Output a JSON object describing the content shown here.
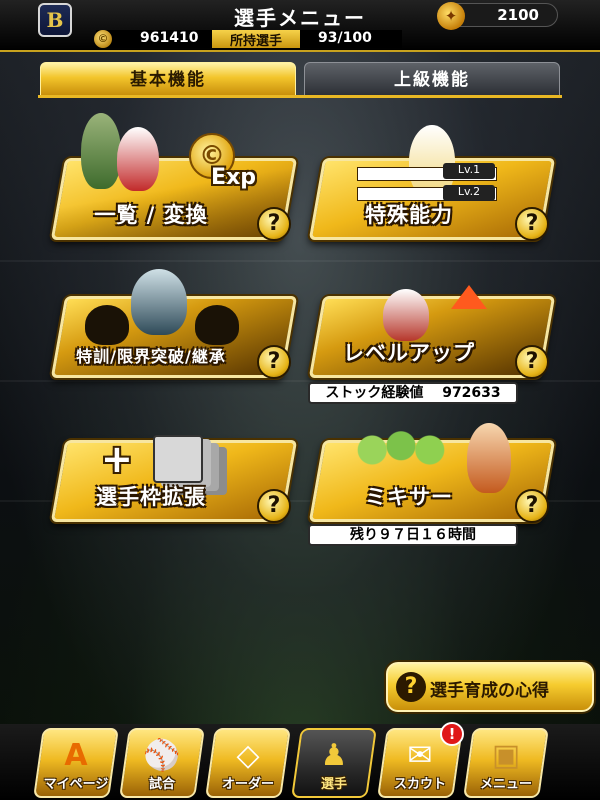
{
  "header": {
    "title": "選手メニュー",
    "team_logo_letter": "B",
    "premium_currency": "2100",
    "coins": "961410",
    "owned_label": "所持選手",
    "owned_count": "93/100"
  },
  "tabs": [
    {
      "label": "基本機能",
      "active": true
    },
    {
      "label": "上級機能",
      "active": false
    }
  ],
  "menu": {
    "list_convert": {
      "label": "一覧 / 変換",
      "exp_badge": "Exp"
    },
    "special_ability": {
      "label": "特殊能力",
      "lv1": "Lv.1",
      "lv2": "Lv.2"
    },
    "training": {
      "label": "特訓/限界突破/継承"
    },
    "level_up": {
      "label": "レベルアップ",
      "stock_label": "ストック経験値",
      "stock_value": "972633"
    },
    "expand_slots": {
      "label": "選手枠拡張"
    },
    "mixer": {
      "label": "ミキサー",
      "remaining": "残り９７日１６時間"
    }
  },
  "help_glyph": "?",
  "tip_button": {
    "label": "選手育成の心得"
  },
  "bottom_nav": [
    {
      "label": "マイページ",
      "icon": "home-A-icon",
      "glyph": "A",
      "selected": false
    },
    {
      "label": "試合",
      "icon": "stadium-icon",
      "glyph": "⚾",
      "selected": false
    },
    {
      "label": "オーダー",
      "icon": "field-order-icon",
      "glyph": "◇",
      "selected": false
    },
    {
      "label": "選手",
      "icon": "player-icon",
      "glyph": "♟",
      "selected": true
    },
    {
      "label": "スカウト",
      "icon": "scout-card-icon",
      "glyph": "✉",
      "selected": false
    },
    {
      "label": "メニュー",
      "icon": "menu-mascot-icon",
      "glyph": "▣",
      "selected": false
    }
  ],
  "notification_badge": "!",
  "colors": {
    "gold": "#f0b81a",
    "gold_light": "#ffe36a",
    "dark": "#0b0f14",
    "badge_red": "#e01818"
  }
}
